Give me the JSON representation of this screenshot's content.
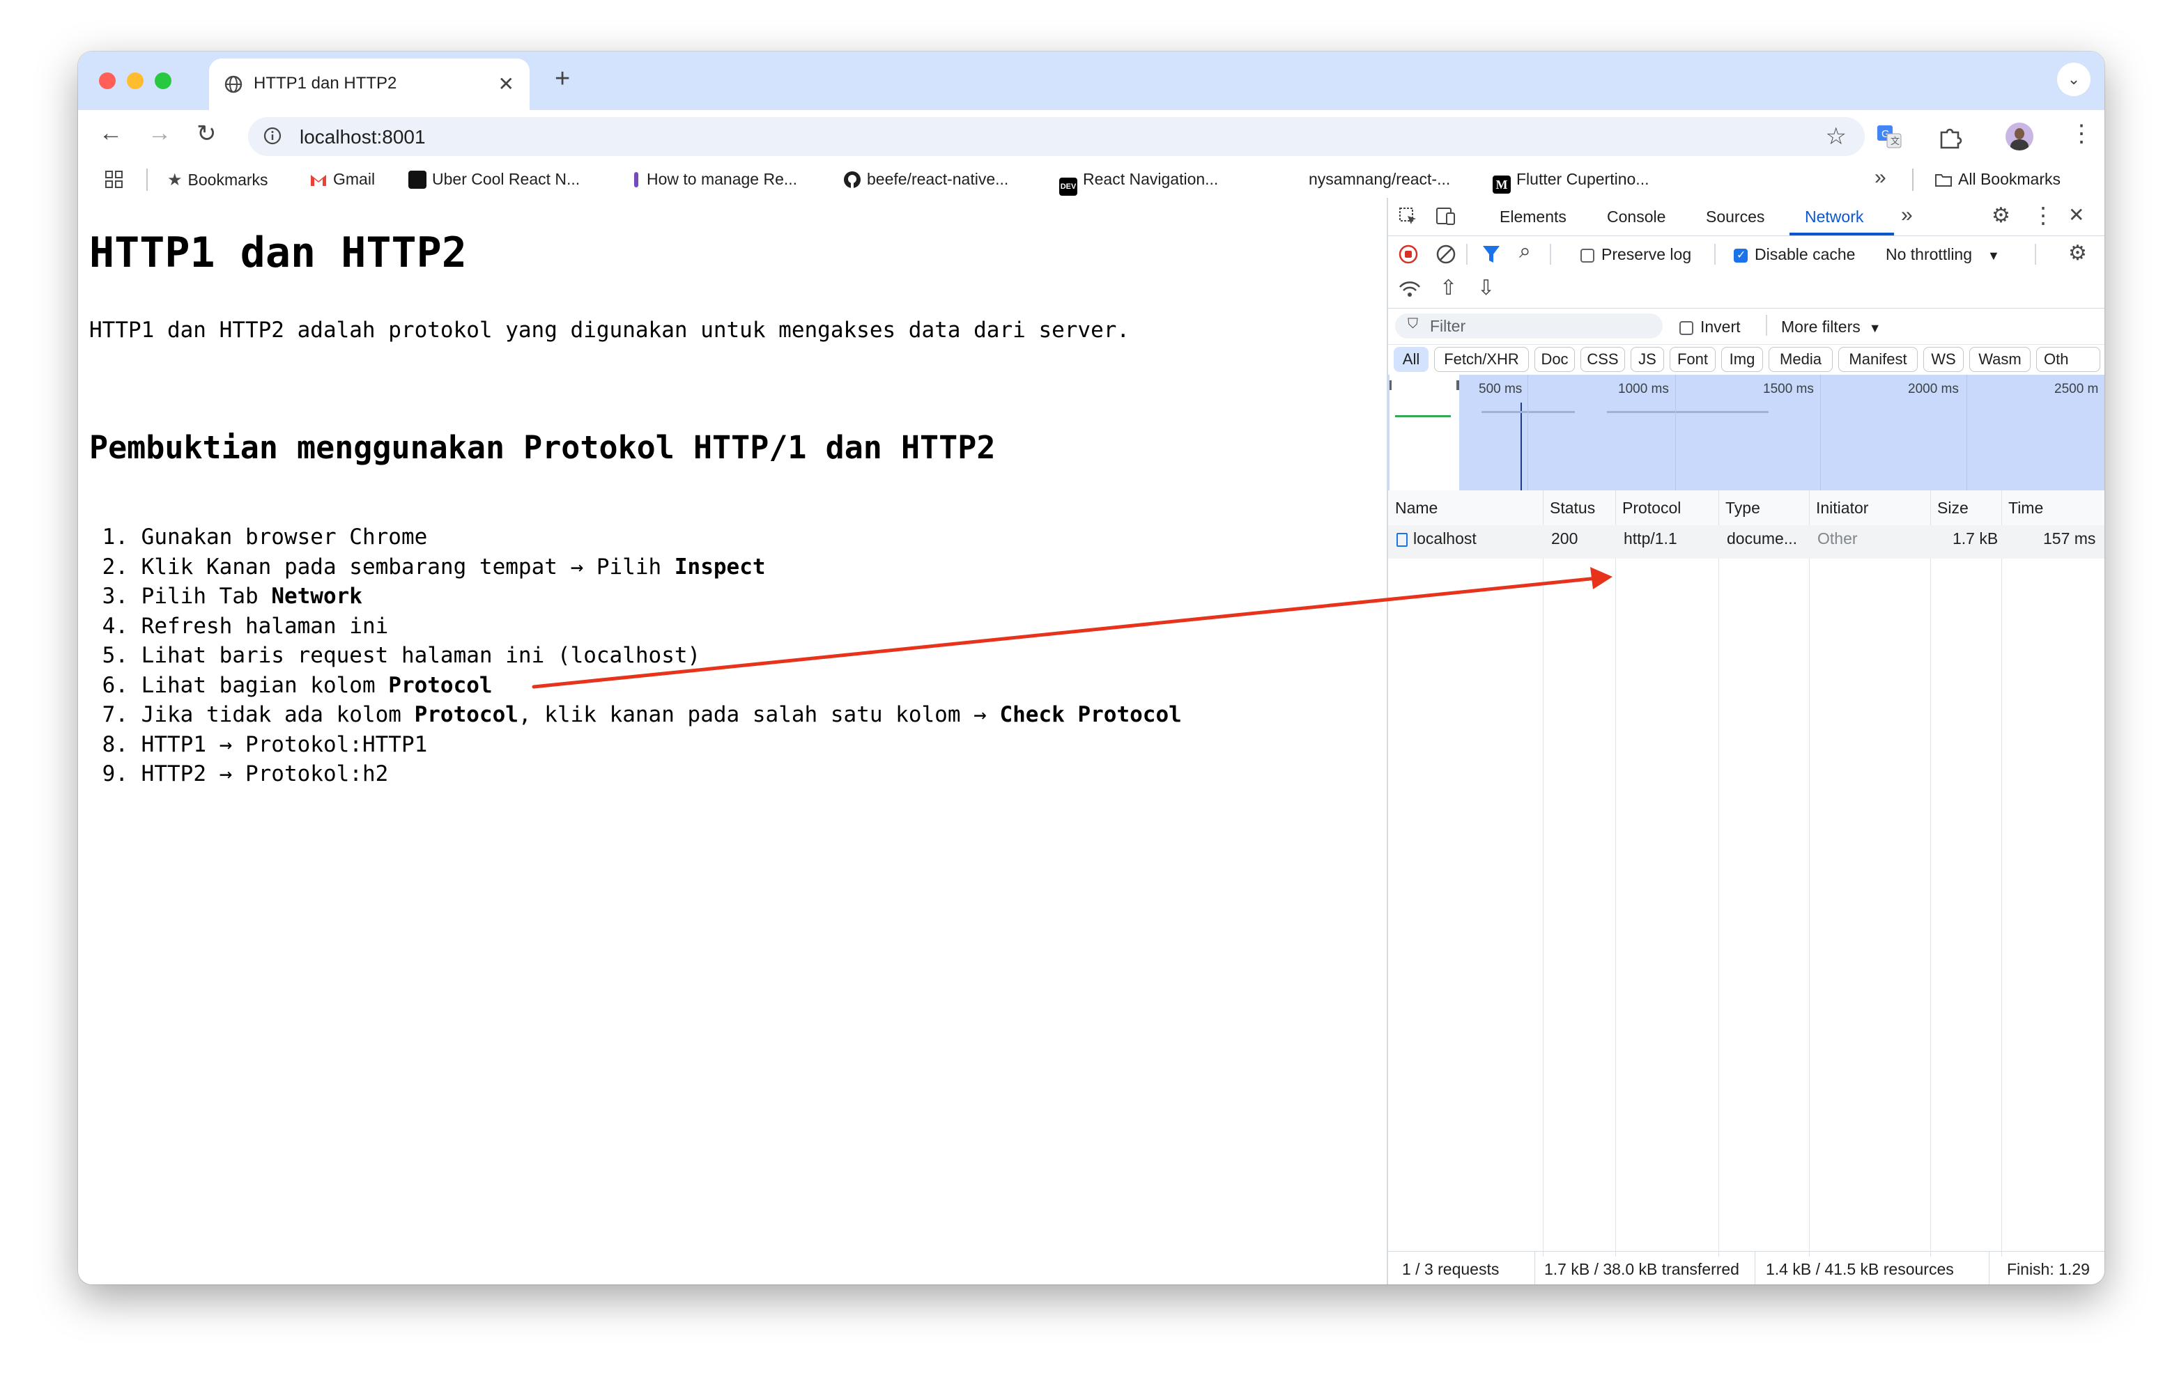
{
  "browser": {
    "tab_title": "HTTP1 dan HTTP2",
    "tab_close": "✕",
    "new_tab": "+",
    "tab_menu": "⌄",
    "url": "localhost:8001",
    "bookmarks": [
      {
        "label": "Bookmarks"
      },
      {
        "label": "Gmail"
      },
      {
        "label": "Uber Cool React N..."
      },
      {
        "label": "How to manage Re..."
      },
      {
        "label": "beefe/react-native..."
      },
      {
        "label": "React Navigation..."
      },
      {
        "label": "nysamnang/react-..."
      },
      {
        "label": "Flutter Cupertino..."
      }
    ],
    "bookmarks_more": "»",
    "all_bookmarks": "All Bookmarks"
  },
  "page": {
    "title": "HTTP1 dan HTTP2",
    "intro": "HTTP1 dan HTTP2 adalah protokol yang digunakan untuk mengakses data dari server.",
    "subtitle": "Pembuktian menggunakan Protokol HTTP/1 dan HTTP2",
    "steps": [
      {
        "num": "1.",
        "text": "Gunakan browser Chrome",
        "bold": ""
      },
      {
        "num": "2.",
        "text": "Klik Kanan pada sembarang tempat → Pilih ",
        "bold": "Inspect"
      },
      {
        "num": "3.",
        "text": "Pilih Tab ",
        "bold": "Network"
      },
      {
        "num": "4.",
        "text": "Refresh halaman ini",
        "bold": ""
      },
      {
        "num": "5.",
        "text": "Lihat baris request halaman ini (localhost)",
        "bold": ""
      },
      {
        "num": "6.",
        "text": "Lihat bagian kolom ",
        "bold": "Protocol"
      },
      {
        "num": "7.",
        "text": "Jika tidak ada kolom ",
        "bold": "Protocol",
        "text2": ", klik kanan pada salah satu kolom → ",
        "bold2": "Check Protocol"
      },
      {
        "num": "8.",
        "text": "HTTP1 → Protokol:HTTP1",
        "bold": ""
      },
      {
        "num": "9.",
        "text": "HTTP2 → Protokol:h2",
        "bold": ""
      }
    ]
  },
  "devtools": {
    "tabs": [
      "Elements",
      "Console",
      "Sources",
      "Network"
    ],
    "active_tab": "Network",
    "more_tabs": "»",
    "preserve_log": "Preserve log",
    "preserve_log_checked": false,
    "disable_cache": "Disable cache",
    "disable_cache_checked": true,
    "throttling": "No throttling",
    "filter_placeholder": "Filter",
    "invert": "Invert",
    "more_filters": "More filters",
    "chips": [
      "All",
      "Fetch/XHR",
      "Doc",
      "CSS",
      "JS",
      "Font",
      "Img",
      "Media",
      "Manifest",
      "WS",
      "Wasm",
      "Oth"
    ],
    "active_chip": "All",
    "timeline_ticks": [
      "500 ms",
      "1000 ms",
      "1500 ms",
      "2000 ms",
      "2500 m"
    ],
    "columns": [
      "Name",
      "Status",
      "Protocol",
      "Type",
      "Initiator",
      "Size",
      "Time"
    ],
    "rows": [
      {
        "name": "localhost",
        "status": "200",
        "protocol": "http/1.1",
        "type": "docume...",
        "initiator": "Other",
        "size": "1.7 kB",
        "time": "157 ms"
      }
    ],
    "statusbar": {
      "requests": "1 / 3 requests",
      "transferred": "1.7 kB / 38.0 kB transferred",
      "resources": "1.4 kB / 41.5 kB resources",
      "finish": "Finish: 1.29"
    }
  },
  "colors": {
    "tabstrip": "#d3e3fd",
    "accent": "#1a73e8",
    "arrow": "#e8331c",
    "overview": "#c8d9fb"
  }
}
